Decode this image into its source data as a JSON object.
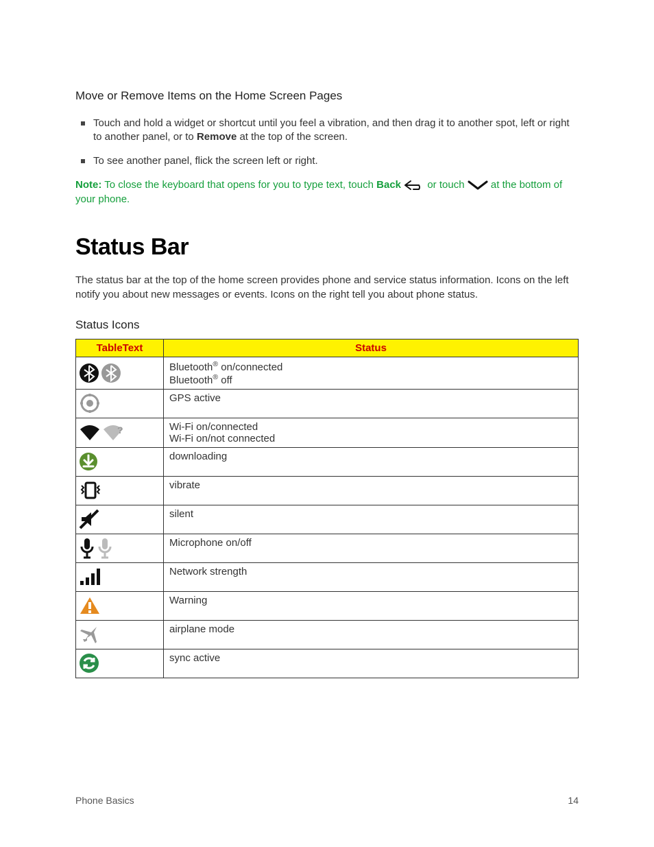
{
  "section1": {
    "heading": "Move or Remove Items on the Home Screen Pages",
    "bullet1_pre": "Touch and hold a widget or shortcut until you feel a vibration, and then drag it to another spot, left or right to another panel, or to ",
    "bullet1_bold": "Remove",
    "bullet1_post": " at the top of the screen.",
    "bullet2": "To see another panel, flick the screen left or right."
  },
  "note": {
    "label": "Note:",
    "t1": " To close the keyboard that opens for you to type text, touch ",
    "back": "Back",
    "t2": " or touch ",
    "t3": " at the bottom of your phone."
  },
  "status_bar": {
    "title": "Status Bar",
    "intro": "The status bar at the top of the home screen provides phone and service status information. Icons on the left notify you about new messages or events. Icons on the right tell you about phone status.",
    "icons_heading": "Status Icons",
    "th_icon": "TableText",
    "th_status": "Status",
    "rows": {
      "r0a": "Bluetooth",
      "r0b": " on/connected",
      "r0c": "Bluetooth",
      "r0d": " off",
      "r1": "GPS active",
      "r2a": "Wi-Fi on/connected",
      "r2b": "Wi-Fi on/not connected",
      "r3": "downloading",
      "r4": "vibrate",
      "r5": "silent",
      "r6": "Microphone on/off",
      "r7": "Network strength",
      "r8": "Warning",
      "r9": "airplane mode",
      "r10": "sync active"
    }
  },
  "footer": {
    "left": "Phone Basics",
    "right": "14"
  },
  "sup": "®"
}
